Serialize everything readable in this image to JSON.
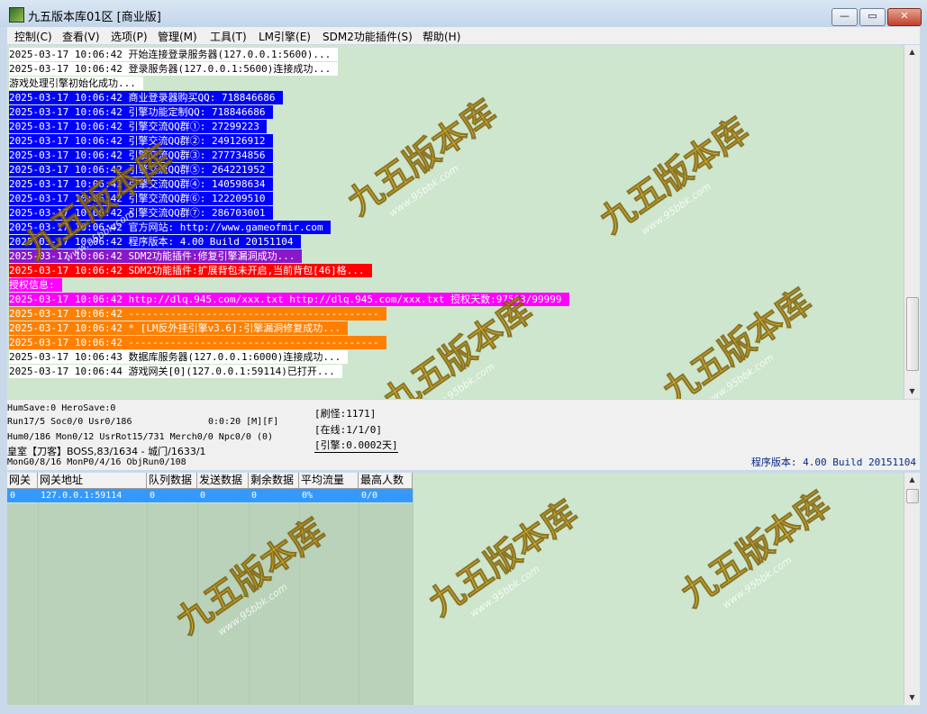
{
  "window": {
    "title": "九五版本库01区 [商业版]",
    "controls": {
      "minimize": "—",
      "maximize": "▭",
      "close": "✕"
    }
  },
  "menu": [
    "控制(C)",
    "查看(V)",
    "选项(P)",
    "管理(M)",
    "工具(T)",
    "LM引擎(E)",
    "SDM2功能插件(S)",
    "帮助(H)"
  ],
  "log": [
    {
      "time": "2025-03-17 10:06:42",
      "msg": "开始连接登录服务器(127.0.0.1:5600)...",
      "style": "white"
    },
    {
      "time": "2025-03-17 10:06:42",
      "msg": "登录服务器(127.0.0.1:5600)连接成功...",
      "style": "white"
    },
    {
      "time": "",
      "msg": "游戏处理引擎初始化成功...",
      "style": "white"
    },
    {
      "time": "2025-03-17 10:06:42",
      "msg": "商业登录器购买QQ: 718846686",
      "style": "blue"
    },
    {
      "time": "2025-03-17 10:06:42",
      "msg": "引擎功能定制QQ: 718846686",
      "style": "blue"
    },
    {
      "time": "2025-03-17 10:06:42",
      "msg": "引擎交流QQ群①: 27299223",
      "style": "blue"
    },
    {
      "time": "2025-03-17 10:06:42",
      "msg": "引擎交流QQ群②: 249126912",
      "style": "blue"
    },
    {
      "time": "2025-03-17 10:06:42",
      "msg": "引擎交流QQ群③: 277734856",
      "style": "blue"
    },
    {
      "time": "2025-03-17 10:06:42",
      "msg": "引擎交流QQ群⑤: 264221952",
      "style": "blue"
    },
    {
      "time": "2025-03-17 10:06:42",
      "msg": "引擎交流QQ群④: 140598634",
      "style": "blue"
    },
    {
      "time": "2025-03-17 10:06:42",
      "msg": "引擎交流QQ群⑥: 122209510",
      "style": "blue"
    },
    {
      "time": "2025-03-17 10:06:42",
      "msg": "引擎交流QQ群⑦: 286703001",
      "style": "blue"
    },
    {
      "time": "2025-03-17 10:06:42",
      "msg": "官方网站: http://www.gameofmir.com",
      "style": "blue"
    },
    {
      "time": "2025-03-17 10:06:42",
      "msg": "程序版本: 4.00 Build 20151104",
      "style": "blue"
    },
    {
      "time": "2025-03-17 10:06:42",
      "msg": "SDM2功能插件:修复引擎漏洞成功...",
      "style": "purple"
    },
    {
      "time": "2025-03-17 10:06:42",
      "msg": "SDM2功能插件:扩展背包未开启,当前背包[46]格...",
      "style": "red"
    },
    {
      "time": "",
      "msg": "授权信息:",
      "style": "magenta"
    },
    {
      "time": "2025-03-17 10:06:42",
      "msg": "http://dlq.945.com/xxx.txt http://dlq.945.com/xxx.txt 授权天数:97563/99999",
      "style": "magenta"
    },
    {
      "time": "2025-03-17 10:06:42",
      "msg": "------------------------------------------",
      "style": "orange"
    },
    {
      "time": "2025-03-17 10:06:42",
      "msg": "* [LM反外挂引擎v3.6]:引擎漏洞修复成功...",
      "style": "orange"
    },
    {
      "time": "2025-03-17 10:06:42",
      "msg": "------------------------------------------",
      "style": "orange"
    },
    {
      "time": "2025-03-17 10:06:43",
      "msg": "数据库服务器(127.0.0.1:6000)连接成功...",
      "style": "white"
    },
    {
      "time": "2025-03-17 10:06:44",
      "msg": "游戏网关[0](127.0.0.1:59114)已打开...",
      "style": "white"
    }
  ],
  "styles": {
    "white": {
      "bg": "#ffffff",
      "fg": "#000000"
    },
    "blue": {
      "bg": "#0000ff",
      "fg": "#ffffff"
    },
    "purple": {
      "bg": "#8a18c8",
      "fg": "#ffffff"
    },
    "red": {
      "bg": "#ff0000",
      "fg": "#ffffff"
    },
    "magenta": {
      "bg": "#ff00ff",
      "fg": "#ffffff"
    },
    "orange": {
      "bg": "#ff8000",
      "fg": "#ffffff"
    }
  },
  "status": {
    "line1": "HumSave:0 HeroSave:0",
    "line2": "Run17/5 Soc0/0 Usr0/186",
    "timer": "0:0:20 [M][F]",
    "line3": "Hum0/186 Mon0/12 UsrRot15/731 Merch0/0 Npc0/0 (0)",
    "line4": "皇室【刀客】BOSS,83/1634 - 城门/1633/1",
    "line5": "MonG0/8/16 MonP0/4/16 ObjRun0/108",
    "refresh": "[刷怪:1171]",
    "online": "[在线:1/1/0]",
    "engine": "[引擎:0.0002天]",
    "version": "程序版本: 4.00 Build 20151104"
  },
  "grid": {
    "headers": [
      "网关",
      "网关地址",
      "队列数据",
      "发送数据",
      "剩余数据",
      "平均流量",
      "最高人数"
    ],
    "rows": [
      [
        "0",
        "127.0.0.1:59114",
        "0",
        "0",
        "0",
        "0%",
        "0/0"
      ]
    ]
  },
  "watermark": {
    "text": "九五版本库",
    "url": "www.95bbk.com",
    "color": "#e8b000"
  }
}
